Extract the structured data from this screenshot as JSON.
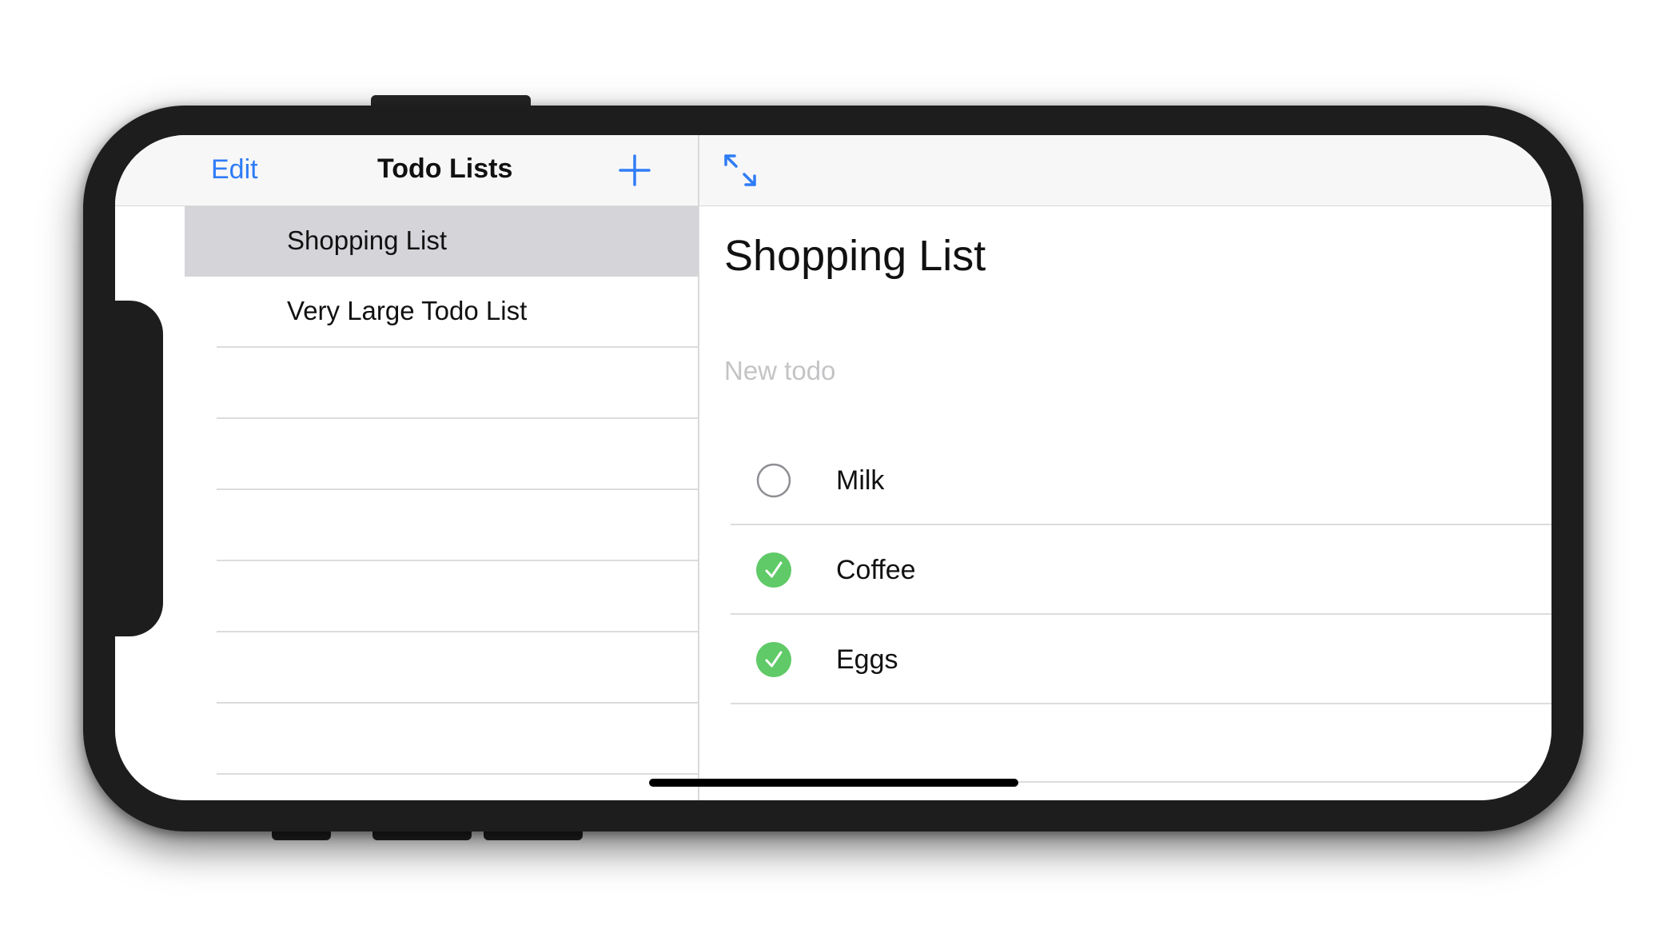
{
  "colors": {
    "accent": "#2f7cf6",
    "check_done": "#5fca67",
    "check_empty_stroke": "#8e8e93",
    "selected_row": "#d4d4d9",
    "placeholder": "#c4c4c6"
  },
  "master": {
    "edit_label": "Edit",
    "title": "Todo Lists",
    "add_icon": "plus-icon",
    "lists": [
      {
        "label": "Shopping List",
        "selected": true
      },
      {
        "label": "Very Large Todo List",
        "selected": false
      }
    ]
  },
  "detail": {
    "expand_icon": "expand-arrows-icon",
    "title": "Shopping List",
    "new_todo_placeholder": "New todo",
    "new_todo_value": "",
    "todos": [
      {
        "label": "Milk",
        "done": false
      },
      {
        "label": "Coffee",
        "done": true
      },
      {
        "label": "Eggs",
        "done": true
      }
    ]
  }
}
